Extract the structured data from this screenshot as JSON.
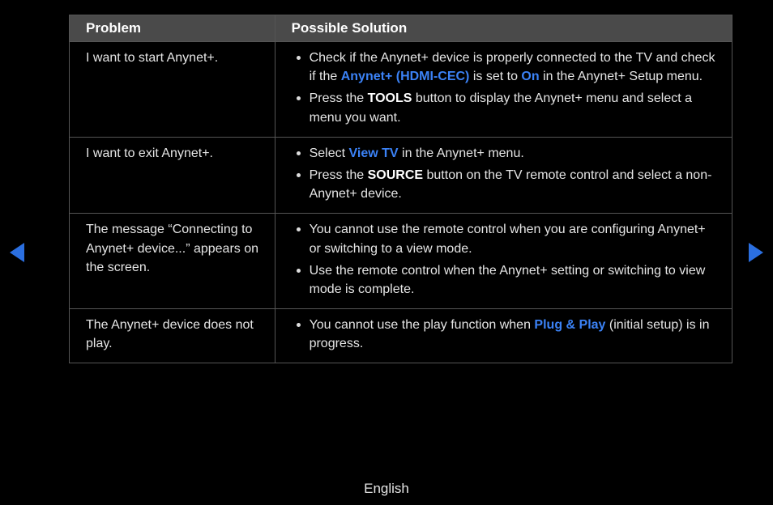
{
  "table": {
    "headers": {
      "problem": "Problem",
      "solution": "Possible Solution"
    },
    "rows": [
      {
        "problem": "I want to start Anynet+.",
        "solutions": [
          {
            "pre": "Check if the Anynet+ device is properly connected to the TV and check if the ",
            "h1": "Anynet+ (HDMI-CEC)",
            "mid1": " is set to ",
            "h2": "On",
            "post": " in the Anynet+ Setup menu."
          },
          {
            "pre": "Press the ",
            "b1": "TOOLS",
            "post": " button to display the Anynet+ menu and select a menu you want."
          }
        ]
      },
      {
        "problem": "I want to exit Anynet+.",
        "solutions": [
          {
            "pre": "Select ",
            "h1": "View TV",
            "post": " in the Anynet+ menu."
          },
          {
            "pre": "Press the ",
            "b1": "SOURCE",
            "post": " button on the TV remote control and select a non- Anynet+ device."
          }
        ]
      },
      {
        "problem": "The message “Connecting to Anynet+ device...” appears on the screen.",
        "solutions": [
          {
            "pre": "You cannot use the remote control when you are configuring Anynet+ or switching to a view mode."
          },
          {
            "pre": "Use the remote control when the Anynet+ setting or switching to view mode is complete."
          }
        ]
      },
      {
        "problem": "The Anynet+ device does not play.",
        "solutions": [
          {
            "pre": "You cannot use the play function when ",
            "h1": "Plug & Play",
            "post": " (initial setup) is in progress."
          }
        ]
      }
    ]
  },
  "footer": {
    "language": "English"
  }
}
